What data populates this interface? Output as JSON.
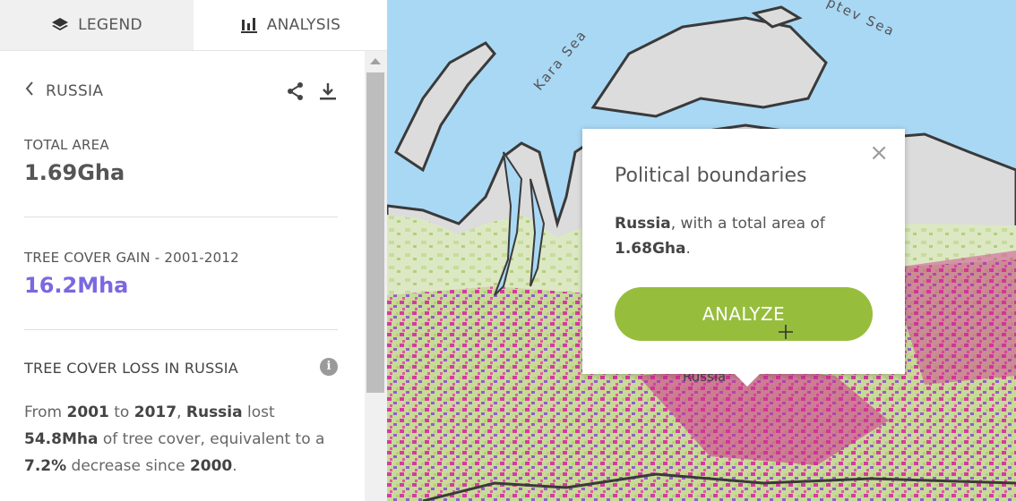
{
  "tabs": {
    "legend": {
      "label": "LEGEND",
      "icon": "layers-icon"
    },
    "analysis": {
      "label": "ANALYSIS",
      "icon": "bar-chart-icon"
    }
  },
  "analysis": {
    "country": "RUSSIA",
    "total_area": {
      "label": "TOTAL AREA",
      "value": "1.69Gha"
    },
    "tree_cover_gain": {
      "label": "TREE COVER GAIN - 2001-2012",
      "value": "16.2Mha",
      "color": "#7a68e0"
    },
    "tree_cover_loss": {
      "title": "TREE COVER LOSS IN RUSSIA",
      "desc": {
        "t1": "From ",
        "start_year": "2001",
        "t2": " to ",
        "end_year": "2017",
        "t3": ", ",
        "country": "Russia",
        "t4": " lost ",
        "loss": "54.8Mha",
        "t5": " of tree cover, equivalent to a ",
        "percent": "7.2%",
        "t6": " decrease since ",
        "base_year": "2000",
        "t7": "."
      }
    }
  },
  "map": {
    "sea_labels": {
      "kara": "Kara Sea",
      "laptev": "ptev Sea"
    },
    "place_label": "Russia"
  },
  "popup": {
    "title": "Political boundaries",
    "country": "Russia",
    "text_mid": ", with a total area of ",
    "area": "1.68Gha",
    "text_end": ".",
    "close": "×",
    "button": "ANALYZE",
    "button_color": "#97bd3d"
  }
}
